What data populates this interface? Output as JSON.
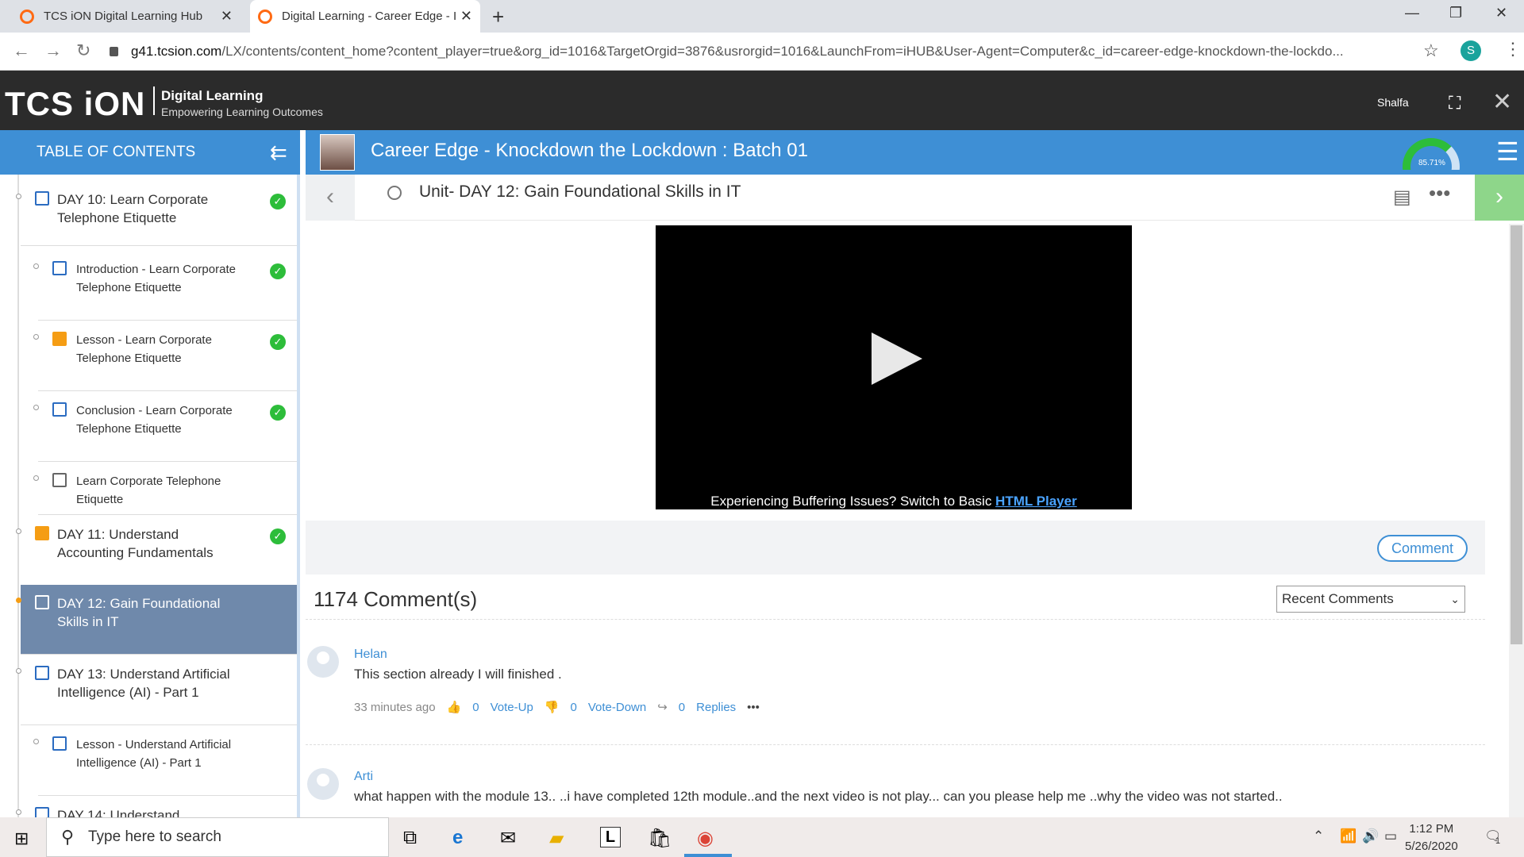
{
  "browser": {
    "tabs": [
      {
        "label": "TCS iON Digital Learning Hub"
      },
      {
        "label": "Digital Learning - Career Edge - I"
      }
    ],
    "url_host": "g41.tcsion.com",
    "url_rest": "/LX/contents/content_home?content_player=true&org_id=1016&TargetOrgid=3876&usrorgid=1016&LaunchFrom=iHUB&User-Agent=Computer&c_id=career-edge-knockdown-the-lockdo...",
    "profile_initial": "S"
  },
  "app": {
    "logo_text": "TCS iON",
    "logo_title": "Digital Learning",
    "logo_tagline": "Empowering Learning Outcomes",
    "user_name": "Shalfa",
    "toc_header": "TABLE OF CONTENTS",
    "course_title": "Career Edge - Knockdown the Lockdown : Batch 01",
    "progress_label": "85.71%",
    "progress_value": 0.8571,
    "accent_color": "#3e8fd5"
  },
  "toc": {
    "items": [
      {
        "label": "DAY 10: Learn Corporate Telephone Etiquette",
        "done": true
      },
      {
        "label": "Introduction - Learn Corporate Telephone Etiquette",
        "done": true
      },
      {
        "label": "Lesson - Learn Corporate Telephone Etiquette",
        "done": true
      },
      {
        "label": "Conclusion - Learn Corporate Telephone Etiquette",
        "done": true
      },
      {
        "label": "Learn Corporate Telephone Etiquette",
        "done": false
      },
      {
        "label": "DAY 11: Understand Accounting Fundamentals",
        "done": true
      },
      {
        "label": "DAY 12: Gain Foundational Skills in IT",
        "done": false,
        "active": true
      },
      {
        "label": "DAY 13: Understand Artificial Intelligence (AI) - Part 1",
        "done": false
      },
      {
        "label": "Lesson - Understand Artificial Intelligence (AI) - Part 1",
        "done": false
      },
      {
        "label": "DAY 14: Understand",
        "done": false
      }
    ]
  },
  "unit": {
    "title": "Unit- DAY 12: Gain Foundational Skills in IT"
  },
  "player": {
    "buffer_text": "Experiencing Buffering Issues? Switch to Basic ",
    "buffer_link": "HTML Player"
  },
  "comments": {
    "button_label": "Comment",
    "count_label": "1174 Comment(s)",
    "sort_selected": "Recent Comments",
    "list": [
      {
        "author": "Helan",
        "text": "This section already I will finished .",
        "time": "33 minutes ago",
        "upvotes": "0",
        "upvote_label": "Vote-Up",
        "downvotes": "0",
        "downvote_label": "Vote-Down",
        "replies": "0",
        "replies_label": "Replies"
      },
      {
        "author": "Arti",
        "text": "what happen with the module 13.. ..i have completed 12th module..and the next video is not play... can you please help me ..why the video was not started.."
      }
    ]
  },
  "taskbar": {
    "search_placeholder": "Type here to search",
    "time": "1:12 PM",
    "date": "5/26/2020",
    "notification_count": "1"
  }
}
